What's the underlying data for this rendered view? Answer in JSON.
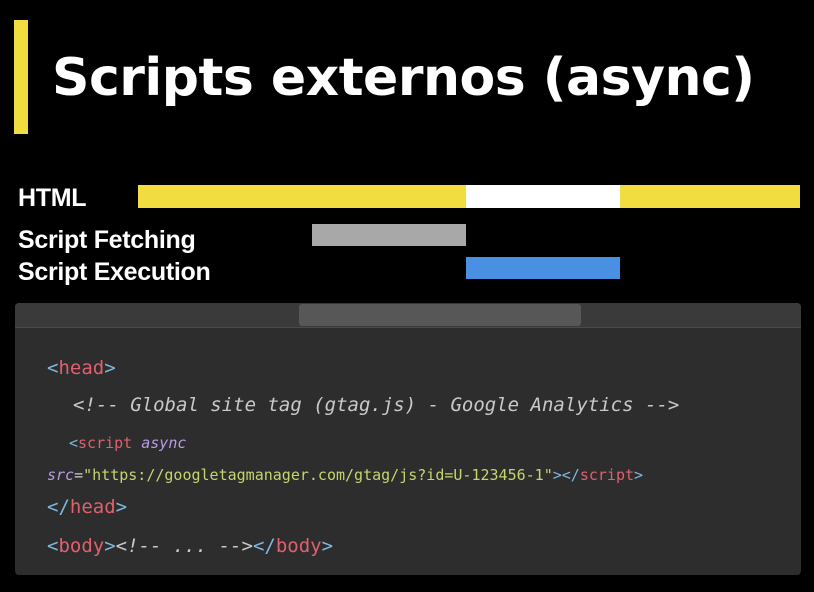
{
  "title": "Scripts externos (async)",
  "colors": {
    "accent": "#f1dd3f",
    "html_parsing": "#f1dd3f",
    "html_paused": "#ffffff",
    "fetching": "#a8a8a8",
    "execution": "#4a90e2",
    "tag": "#e25f6f",
    "bracket": "#7fb8e0",
    "attr": "#b99ae8",
    "string": "#c4d66c"
  },
  "timeline": {
    "rows": [
      {
        "label": "HTML"
      },
      {
        "label": "Script Fetching"
      },
      {
        "label": "Script Execution"
      }
    ]
  },
  "code": {
    "lt": "<",
    "gt": ">",
    "close_lt": "</",
    "open_head": "head",
    "comment": "<!-- Global site tag (gtag.js) - Google Analytics -->",
    "script_tag": "script",
    "async_attr": "async",
    "src_attr": "src",
    "eq": "=",
    "src_value": "\"https://googletagmanager.com/gtag/js?id=U-123456-1\"",
    "close_script": "script",
    "close_head": "head",
    "body_tag": "body",
    "body_comment": "<!-- ... -->",
    "close_body": "body"
  }
}
